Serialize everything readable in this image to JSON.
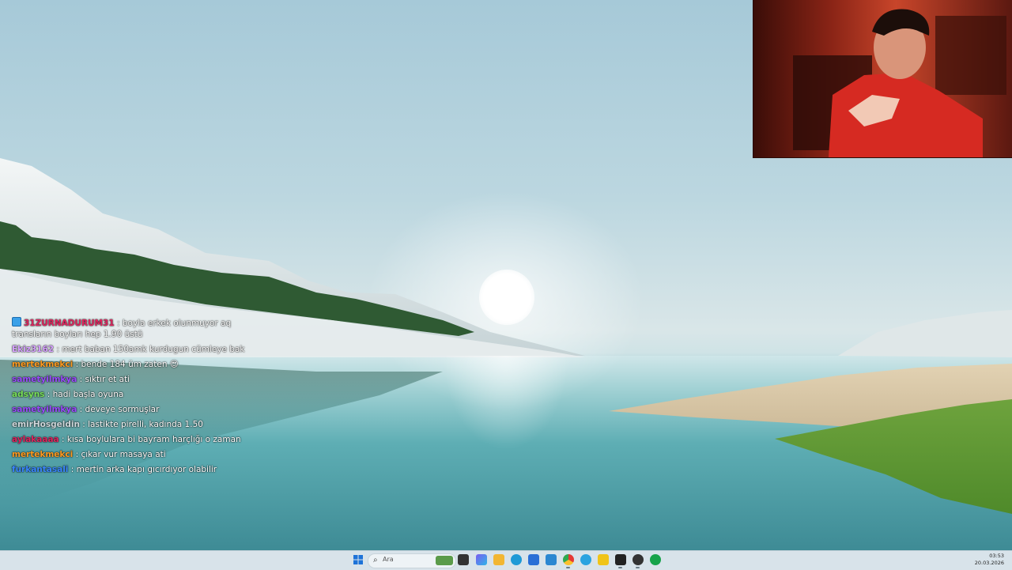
{
  "chat": {
    "messages": [
      {
        "user": "31ZURNADURUM31",
        "color": "#e0245e",
        "text": ": boyla erkek olunmuyor aq transların boyları hep 1.90 üstü",
        "badge": true
      },
      {
        "user": "Ekiz3162",
        "color": "#d6a0ff",
        "text": ": mert baban 150amk kurdugun cümleye bak"
      },
      {
        "user": "mertekmekci",
        "color": "#ff9a1f",
        "text": ": bende 184 üm zaten 😍"
      },
      {
        "user": "sametyilmkya",
        "color": "#9a4bff",
        "text": ": sıktır et ati"
      },
      {
        "user": "adsyns",
        "color": "#79e05a",
        "text": ": hadi başla oyuna"
      },
      {
        "user": "sametyilmkya",
        "color": "#9a4bff",
        "text": ": deveye sormuşlar"
      },
      {
        "user": "emirHosgeldin",
        "color": "#d0d8dc",
        "text": ": lastikte pirelli, kadında 1.50"
      },
      {
        "user": "aylakaaaa",
        "color": "#e0245e",
        "text": ": kısa boylulara bi bayram harçlığı o zaman"
      },
      {
        "user": "mertekmekci",
        "color": "#ff9a1f",
        "text": ": çıkar vur masaya ati"
      },
      {
        "user": "furkantasali",
        "color": "#3a86ff",
        "text": ": mertin arka kapı gıcırdıyor olabilir"
      }
    ]
  },
  "taskbar": {
    "search_placeholder": "Ara",
    "time": "03:53",
    "date": "20.03.2026",
    "icons": [
      {
        "name": "start-icon",
        "color": "#1e73d8"
      },
      {
        "name": "task-view-icon",
        "color": "#333333"
      },
      {
        "name": "copilot-icon",
        "color": "#7a5cf0"
      },
      {
        "name": "file-explorer-icon",
        "color": "#f2b632"
      },
      {
        "name": "edge-icon",
        "color": "#1f9ad6"
      },
      {
        "name": "store-icon",
        "color": "#2a6fd6"
      },
      {
        "name": "vscode-icon",
        "color": "#2b87d1"
      },
      {
        "name": "chrome-icon",
        "color": "#2fa84f"
      },
      {
        "name": "telegram-icon",
        "color": "#2aa3e0"
      },
      {
        "name": "notes-icon",
        "color": "#f0c419"
      },
      {
        "name": "media-app-icon",
        "color": "#222222"
      },
      {
        "name": "obs-icon",
        "color": "#333333"
      },
      {
        "name": "discord-icon",
        "color": "#16a34a"
      }
    ]
  }
}
